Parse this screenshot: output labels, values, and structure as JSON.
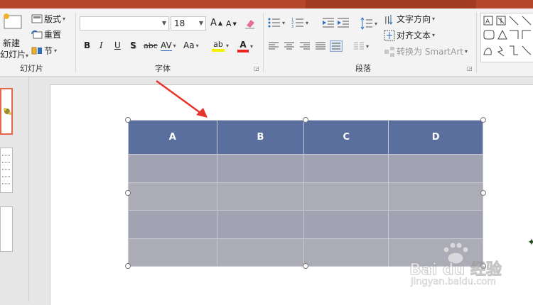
{
  "ribbon": {
    "slides_group": {
      "label": "幻灯片",
      "new_slide_line1": "新建",
      "new_slide_line2": "幻灯片",
      "layout": "版式",
      "reset": "重置",
      "section": "节"
    },
    "font_group": {
      "label": "字体",
      "font_name": "",
      "font_size": "18",
      "bold": "B",
      "italic": "I",
      "underline": "U",
      "shadow": "S",
      "strike": "abc",
      "spacing": "AV",
      "case": "Aa",
      "grow": "A",
      "shrink": "A",
      "highlight_letter": "ab",
      "color_letter": "A"
    },
    "paragraph_group": {
      "label": "段落",
      "text_direction": "文字方向",
      "align_text": "对齐文本",
      "convert_smartart": "转换为 SmartArt"
    }
  },
  "table": {
    "headers": [
      "A",
      "B",
      "C",
      "D"
    ],
    "rows": [
      [
        "",
        "",
        "",
        ""
      ],
      [
        "",
        "",
        "",
        ""
      ],
      [
        "",
        "",
        "",
        ""
      ],
      [
        "",
        "",
        "",
        ""
      ]
    ]
  },
  "colors": {
    "title_bar": "#b7472a",
    "table_header": "#5b6f9e",
    "table_body": "#a1a3b2",
    "arrow": "#e8332a"
  },
  "watermark": {
    "text": "Bai du 经验",
    "url": "jingyan.baidu.com"
  }
}
